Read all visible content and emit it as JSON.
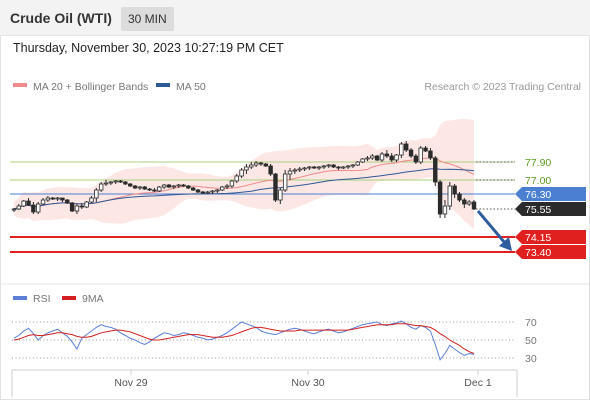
{
  "header": {
    "instrument": "Crude Oil (WTI)",
    "timeframe": "30 MIN"
  },
  "datetime": "Thursday, November 30, 2023 10:27:19 PM CET",
  "copyright": "Research © 2023 Trading Central",
  "colors": {
    "candle": "#2b2b2b",
    "ma20": "#f08a8a",
    "bollinger_fill": "#fbe3e0",
    "ma50": "#2f5896",
    "resistance": "#a8cf7f",
    "pivot": "#4a7fd1",
    "support": "#e01f1f",
    "current_price": "#2b2b2b",
    "arrow": "#2f5d9e",
    "rsi": "#5b7fd6",
    "rsi_ma": "#d22020"
  },
  "chart_data": [
    {
      "type": "candlestick",
      "title": "",
      "legend": [
        {
          "name": "MA 20 + Bollinger Bands",
          "color": "#f08a8a"
        },
        {
          "name": "MA 50",
          "color": "#2f5896"
        }
      ],
      "legend_position": "top-left",
      "x_ticks": [
        "Nov 29",
        "Nov 30",
        "Dec 1"
      ],
      "levels": [
        {
          "label": "77.90",
          "value": 77.9,
          "kind": "resistance"
        },
        {
          "label": "77.00",
          "value": 77.0,
          "kind": "resistance"
        },
        {
          "label": "76.30",
          "value": 76.3,
          "kind": "pivot"
        },
        {
          "label": "75.55",
          "value": 75.55,
          "kind": "current"
        },
        {
          "label": "74.15",
          "value": 74.15,
          "kind": "support"
        },
        {
          "label": "73.40",
          "value": 73.4,
          "kind": "support"
        }
      ],
      "forecast": "down",
      "candles": [
        [
          75.5,
          75.6,
          75.4,
          75.55
        ],
        [
          75.55,
          75.8,
          75.5,
          75.7
        ],
        [
          75.7,
          76.0,
          75.65,
          75.95
        ],
        [
          75.95,
          76.1,
          75.7,
          75.75
        ],
        [
          75.75,
          75.9,
          75.3,
          75.4
        ],
        [
          75.4,
          75.9,
          75.3,
          75.8
        ],
        [
          75.8,
          76.1,
          75.75,
          76.0
        ],
        [
          76.0,
          76.2,
          75.9,
          76.1
        ],
        [
          76.1,
          76.15,
          76.0,
          76.05
        ],
        [
          76.05,
          76.15,
          75.95,
          76.1
        ],
        [
          76.1,
          76.1,
          75.9,
          76.0
        ],
        [
          76.0,
          76.05,
          75.8,
          75.85
        ],
        [
          75.85,
          75.9,
          75.4,
          75.45
        ],
        [
          75.45,
          75.8,
          75.3,
          75.7
        ],
        [
          75.7,
          75.85,
          75.55,
          75.65
        ],
        [
          75.65,
          75.95,
          75.6,
          75.9
        ],
        [
          75.9,
          76.2,
          75.85,
          76.1
        ],
        [
          76.1,
          76.6,
          75.9,
          76.5
        ],
        [
          76.5,
          76.9,
          76.4,
          76.8
        ],
        [
          76.8,
          77.0,
          76.7,
          76.85
        ],
        [
          76.85,
          76.95,
          76.75,
          76.9
        ],
        [
          76.9,
          77.0,
          76.8,
          76.95
        ],
        [
          76.95,
          77.0,
          76.85,
          76.9
        ],
        [
          76.9,
          76.95,
          76.75,
          76.8
        ],
        [
          76.8,
          76.85,
          76.65,
          76.7
        ],
        [
          76.7,
          76.75,
          76.55,
          76.6
        ],
        [
          76.6,
          76.7,
          76.5,
          76.65
        ],
        [
          76.65,
          76.7,
          76.5,
          76.55
        ],
        [
          76.55,
          76.6,
          76.45,
          76.5
        ],
        [
          76.5,
          76.6,
          76.4,
          76.45
        ],
        [
          76.45,
          76.7,
          76.4,
          76.65
        ],
        [
          76.65,
          76.8,
          76.55,
          76.75
        ],
        [
          76.75,
          76.8,
          76.6,
          76.65
        ],
        [
          76.65,
          76.75,
          76.55,
          76.7
        ],
        [
          76.7,
          76.8,
          76.6,
          76.75
        ],
        [
          76.75,
          76.8,
          76.65,
          76.7
        ],
        [
          76.7,
          76.75,
          76.55,
          76.6
        ],
        [
          76.6,
          76.65,
          76.45,
          76.5
        ],
        [
          76.5,
          76.55,
          76.35,
          76.4
        ],
        [
          76.4,
          76.45,
          76.3,
          76.35
        ],
        [
          76.35,
          76.45,
          76.3,
          76.4
        ],
        [
          76.4,
          76.5,
          76.3,
          76.45
        ],
        [
          76.45,
          76.55,
          76.35,
          76.5
        ],
        [
          76.5,
          76.7,
          76.45,
          76.65
        ],
        [
          76.65,
          76.8,
          76.55,
          76.7
        ],
        [
          76.7,
          77.0,
          76.6,
          76.95
        ],
        [
          76.95,
          77.3,
          76.85,
          77.2
        ],
        [
          77.2,
          77.6,
          77.1,
          77.5
        ],
        [
          77.5,
          77.8,
          77.3,
          77.65
        ],
        [
          77.65,
          77.9,
          77.55,
          77.75
        ],
        [
          77.75,
          77.95,
          77.65,
          77.85
        ],
        [
          77.85,
          77.9,
          77.7,
          77.8
        ],
        [
          77.8,
          77.85,
          77.65,
          77.7
        ],
        [
          77.7,
          77.8,
          77.2,
          77.3
        ],
        [
          77.3,
          77.35,
          75.9,
          76.0
        ],
        [
          76.0,
          76.6,
          75.8,
          76.5
        ],
        [
          76.5,
          77.5,
          76.4,
          77.3
        ],
        [
          77.3,
          77.6,
          77.0,
          77.45
        ],
        [
          77.45,
          77.6,
          77.3,
          77.5
        ],
        [
          77.5,
          77.65,
          77.4,
          77.55
        ],
        [
          77.55,
          77.65,
          77.45,
          77.6
        ],
        [
          77.6,
          77.7,
          77.5,
          77.65
        ],
        [
          77.65,
          77.7,
          77.55,
          77.6
        ],
        [
          77.6,
          77.7,
          77.5,
          77.65
        ],
        [
          77.65,
          77.75,
          77.55,
          77.7
        ],
        [
          77.7,
          77.8,
          77.6,
          77.75
        ],
        [
          77.75,
          77.8,
          77.6,
          77.65
        ],
        [
          77.65,
          77.7,
          77.5,
          77.6
        ],
        [
          77.6,
          77.7,
          77.55,
          77.65
        ],
        [
          77.65,
          77.75,
          77.55,
          77.7
        ],
        [
          77.7,
          77.8,
          77.6,
          77.75
        ],
        [
          77.75,
          77.95,
          77.7,
          77.9
        ],
        [
          77.9,
          78.1,
          77.85,
          78.05
        ],
        [
          78.05,
          78.2,
          77.95,
          78.1
        ],
        [
          78.1,
          78.3,
          78.0,
          78.2
        ],
        [
          78.2,
          78.25,
          77.95,
          78.0
        ],
        [
          78.0,
          78.4,
          77.9,
          78.3
        ],
        [
          78.3,
          78.5,
          78.1,
          78.2
        ],
        [
          78.2,
          78.35,
          77.9,
          78.0
        ],
        [
          78.0,
          78.3,
          77.9,
          78.25
        ],
        [
          78.25,
          78.9,
          78.1,
          78.8
        ],
        [
          78.8,
          78.95,
          78.4,
          78.5
        ],
        [
          78.5,
          78.6,
          78.1,
          78.2
        ],
        [
          78.2,
          78.3,
          77.8,
          77.9
        ],
        [
          77.9,
          78.7,
          77.8,
          78.6
        ],
        [
          78.6,
          78.7,
          78.4,
          78.45
        ],
        [
          78.45,
          78.6,
          78.0,
          78.1
        ],
        [
          78.1,
          78.2,
          76.7,
          76.9
        ],
        [
          76.9,
          77.0,
          75.1,
          75.3
        ],
        [
          75.3,
          76.0,
          75.1,
          75.7
        ],
        [
          75.7,
          76.9,
          75.5,
          76.7
        ],
        [
          76.7,
          76.8,
          76.1,
          76.3
        ],
        [
          76.3,
          76.4,
          75.9,
          76.0
        ],
        [
          76.0,
          76.1,
          75.6,
          75.8
        ],
        [
          75.8,
          76.0,
          75.7,
          75.9
        ],
        [
          75.9,
          76.0,
          75.5,
          75.55
        ]
      ]
    },
    {
      "type": "line",
      "legend": [
        {
          "name": "RSI",
          "color": "#5b7fd6"
        },
        {
          "name": "9MA",
          "color": "#d22020"
        }
      ],
      "y_ticks": [
        "70",
        "50",
        "30"
      ],
      "ylim": [
        20,
        80
      ],
      "series": [
        {
          "name": "RSI",
          "values": [
            52,
            55,
            60,
            63,
            57,
            50,
            55,
            58,
            60,
            62,
            58,
            54,
            48,
            40,
            52,
            56,
            60,
            64,
            67,
            65,
            64,
            62,
            58,
            55,
            52,
            50,
            47,
            45,
            48,
            52,
            55,
            58,
            57,
            55,
            56,
            58,
            57,
            55,
            53,
            52,
            50,
            51,
            53,
            55,
            58,
            62,
            66,
            70,
            68,
            66,
            64,
            60,
            58,
            57,
            56,
            58,
            60,
            62,
            63,
            62,
            60,
            58,
            57,
            59,
            61,
            62,
            60,
            58,
            59,
            61,
            63,
            65,
            67,
            68,
            69,
            70,
            67,
            66,
            68,
            69,
            71,
            68,
            64,
            62,
            66,
            64,
            60,
            45,
            28,
            35,
            44,
            40,
            36,
            33,
            35,
            34
          ]
        },
        {
          "name": "9MA",
          "values": [
            50,
            51,
            53,
            55,
            56,
            55,
            55,
            56,
            57,
            58,
            58,
            57,
            56,
            54,
            53,
            53,
            54,
            56,
            58,
            59,
            60,
            61,
            61,
            60,
            59,
            57,
            55,
            53,
            51,
            50,
            50,
            51,
            52,
            53,
            54,
            55,
            56,
            56,
            56,
            55,
            54,
            53,
            53,
            53,
            54,
            55,
            57,
            59,
            61,
            63,
            64,
            64,
            63,
            62,
            61,
            60,
            60,
            60,
            60,
            61,
            61,
            61,
            61,
            61,
            61,
            61,
            61,
            61,
            61,
            61,
            62,
            63,
            64,
            65,
            66,
            67,
            67,
            67,
            67,
            68,
            68,
            68,
            67,
            66,
            66,
            65,
            64,
            61,
            57,
            54,
            50,
            47,
            44,
            40,
            37,
            35
          ]
        }
      ]
    }
  ]
}
